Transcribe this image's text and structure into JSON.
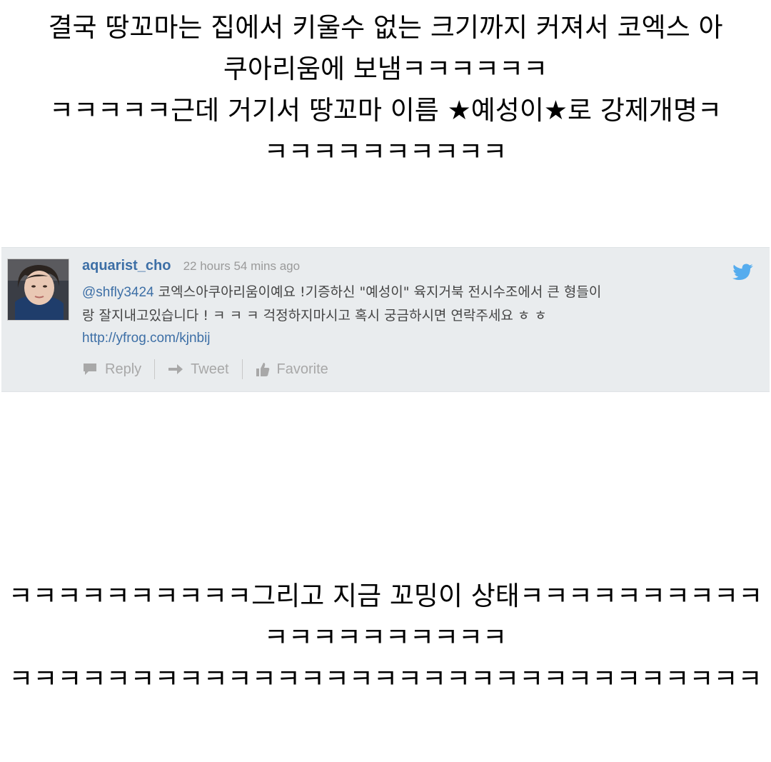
{
  "caption_top": {
    "lines": [
      "결국 땅꼬마는 집에서 키울수 없는 크기까지 커져서 코엑스 아",
      "쿠아리움에 보냄ㅋㅋㅋㅋㅋㅋ",
      "ㅋㅋㅋㅋㅋ근데 거기서 땅꼬마 이름 ★예성이★로 강제개명ㅋ",
      "ㅋㅋㅋㅋㅋㅋㅋㅋㅋㅋ"
    ]
  },
  "tweet": {
    "username": "aquarist_cho",
    "timestamp": "22 hours 54 mins ago",
    "mention": "@shfly3424",
    "body_line1": " 코엑스아쿠아리움이예요 !기증하신 \"예성이\" 육지거북 전시수조에서 큰 형들이",
    "body_line2": "랑 잘지내고있습니다 ! ㅋ ㅋ ㅋ  걱정하지마시고 혹시 궁금하시면 연락주세요 ㅎ ㅎ",
    "link": "http://yfrog.com/kjnbij",
    "actions": {
      "reply": "Reply",
      "retweet": "Tweet",
      "favorite": "Favorite"
    },
    "icons": {
      "avatar": "profile-photo",
      "platform": "twitter-bird-icon",
      "reply": "speech-bubble-icon",
      "retweet": "arrow-right-icon",
      "favorite": "thumbs-up-icon"
    },
    "colors": {
      "background": "#e9ecee",
      "username": "#3d6fa6",
      "muted": "#a8a8a8",
      "bird": "#55acee"
    }
  },
  "caption_bottom": {
    "lines": [
      "ㅋㅋㅋㅋㅋㅋㅋㅋㅋㅋ그리고 지금 꼬밍이 상태ㅋㅋㅋㅋㅋㅋㅋㅋㅋㅋ",
      "ㅋㅋㅋㅋㅋㅋㅋㅋㅋㅋ",
      "ㅋㅋㅋㅋㅋㅋㅋㅋㅋㅋㅋㅋㅋㅋㅋㅋㅋㅋㅋㅋㅋㅋㅋㅋㅋㅋㅋㅋㅋㅋㅋ"
    ]
  }
}
